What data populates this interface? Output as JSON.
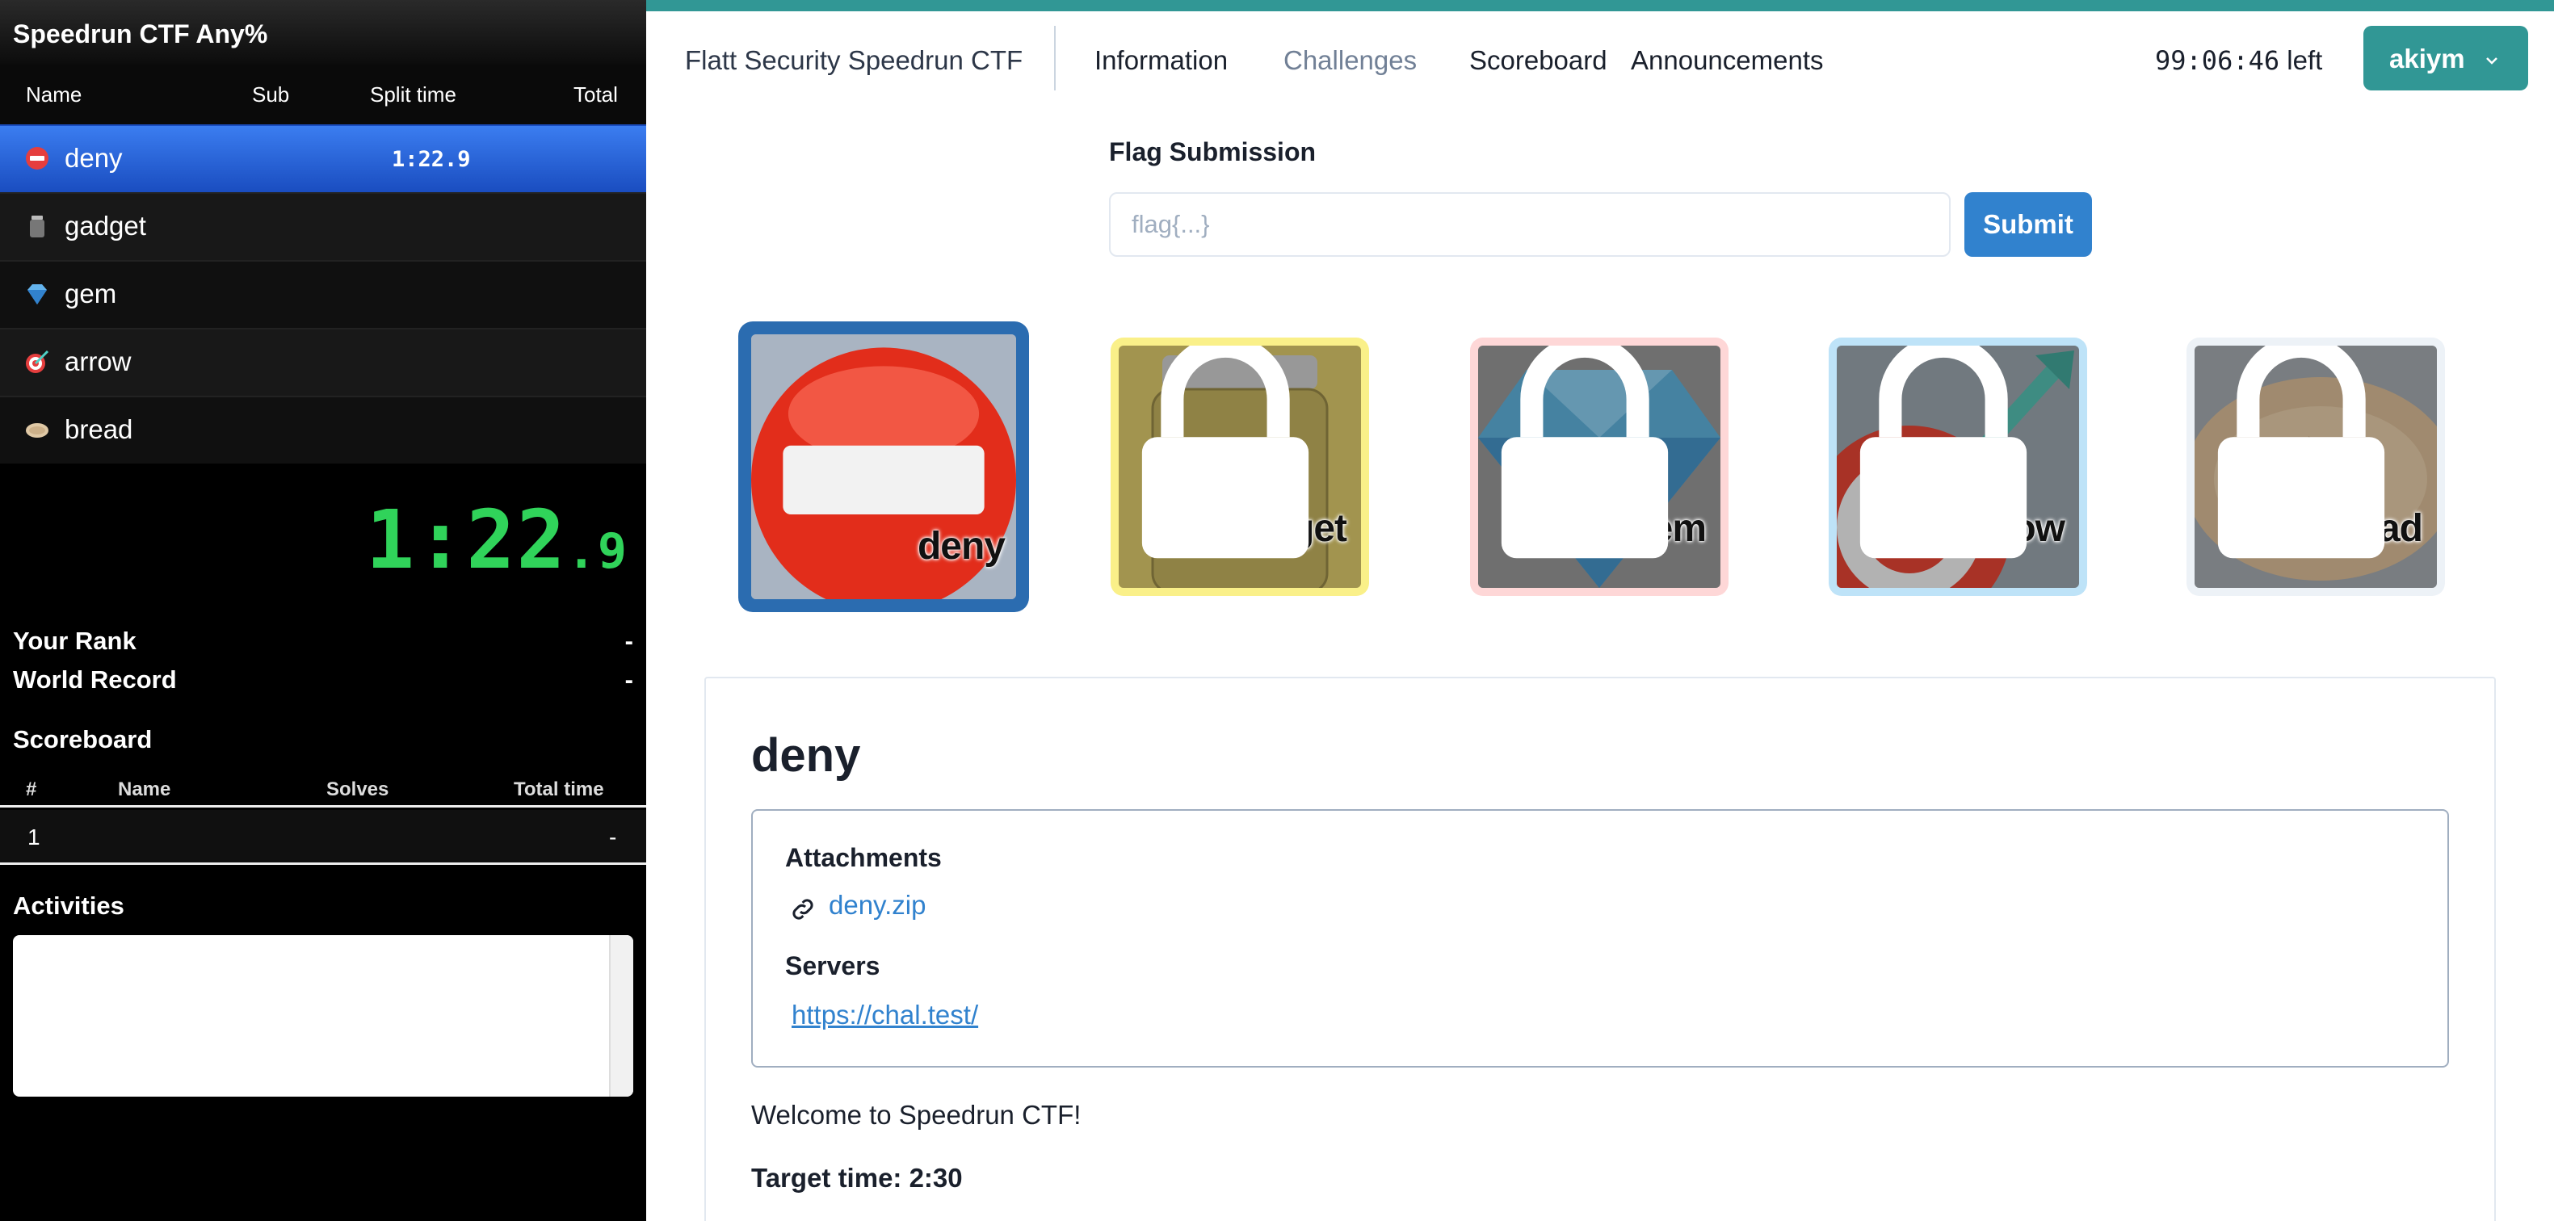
{
  "sidebar": {
    "title": "Speedrun CTF Any%",
    "columns": {
      "name": "Name",
      "sub": "Sub",
      "split_time": "Split time",
      "total": "Total"
    },
    "splits": [
      {
        "name": "deny",
        "split_time": "1:22.9",
        "icon": "no-entry-icon",
        "active": true
      },
      {
        "name": "gadget",
        "split_time": "",
        "icon": "jar-icon",
        "active": false
      },
      {
        "name": "gem",
        "split_time": "",
        "icon": "gem-icon",
        "active": false
      },
      {
        "name": "arrow",
        "split_time": "",
        "icon": "target-icon",
        "active": false
      },
      {
        "name": "bread",
        "split_time": "",
        "icon": "flatbread-icon",
        "active": false
      }
    ],
    "timer": {
      "main": "1:22",
      "fraction": ".9"
    },
    "your_rank": {
      "label": "Your Rank",
      "value": "-"
    },
    "world_record": {
      "label": "World Record",
      "value": "-"
    },
    "scoreboard": {
      "title": "Scoreboard",
      "columns": {
        "rank": "#",
        "name": "Name",
        "solves": "Solves",
        "total_time": "Total time"
      },
      "rows": [
        {
          "rank": "1",
          "name": "",
          "solves": "",
          "total_time": "-"
        }
      ]
    },
    "activities": {
      "title": "Activities"
    }
  },
  "header": {
    "brand": "Flatt Security Speedrun CTF",
    "nav": [
      "Information",
      "Challenges",
      "Scoreboard",
      "Announcements"
    ],
    "countdown": {
      "time": "99:06:46",
      "suffix": "left"
    },
    "user": "akiym",
    "accent_color": "#319795"
  },
  "flag_form": {
    "label": "Flag Submission",
    "placeholder": "flag{...}",
    "value": "",
    "submit_label": "Submit"
  },
  "challenges": [
    {
      "name": "deny",
      "locked": false,
      "selected": true,
      "frame_color": "#2b6cb0"
    },
    {
      "name": "gadget",
      "locked": true,
      "selected": false,
      "frame_color": "#faf089"
    },
    {
      "name": "gem",
      "locked": true,
      "selected": false,
      "frame_color": "#fed7d7"
    },
    {
      "name": "arrow",
      "locked": true,
      "selected": false,
      "frame_color": "#bee3f8"
    },
    {
      "name": "bread",
      "locked": true,
      "selected": false,
      "frame_color": "#edf2f7"
    }
  ],
  "detail": {
    "title": "deny",
    "attachments_label": "Attachments",
    "attachment": "deny.zip",
    "servers_label": "Servers",
    "server": "https://chal.test/",
    "description": "Welcome to Speedrun CTF!",
    "target_time": "Target time: 2:30"
  }
}
